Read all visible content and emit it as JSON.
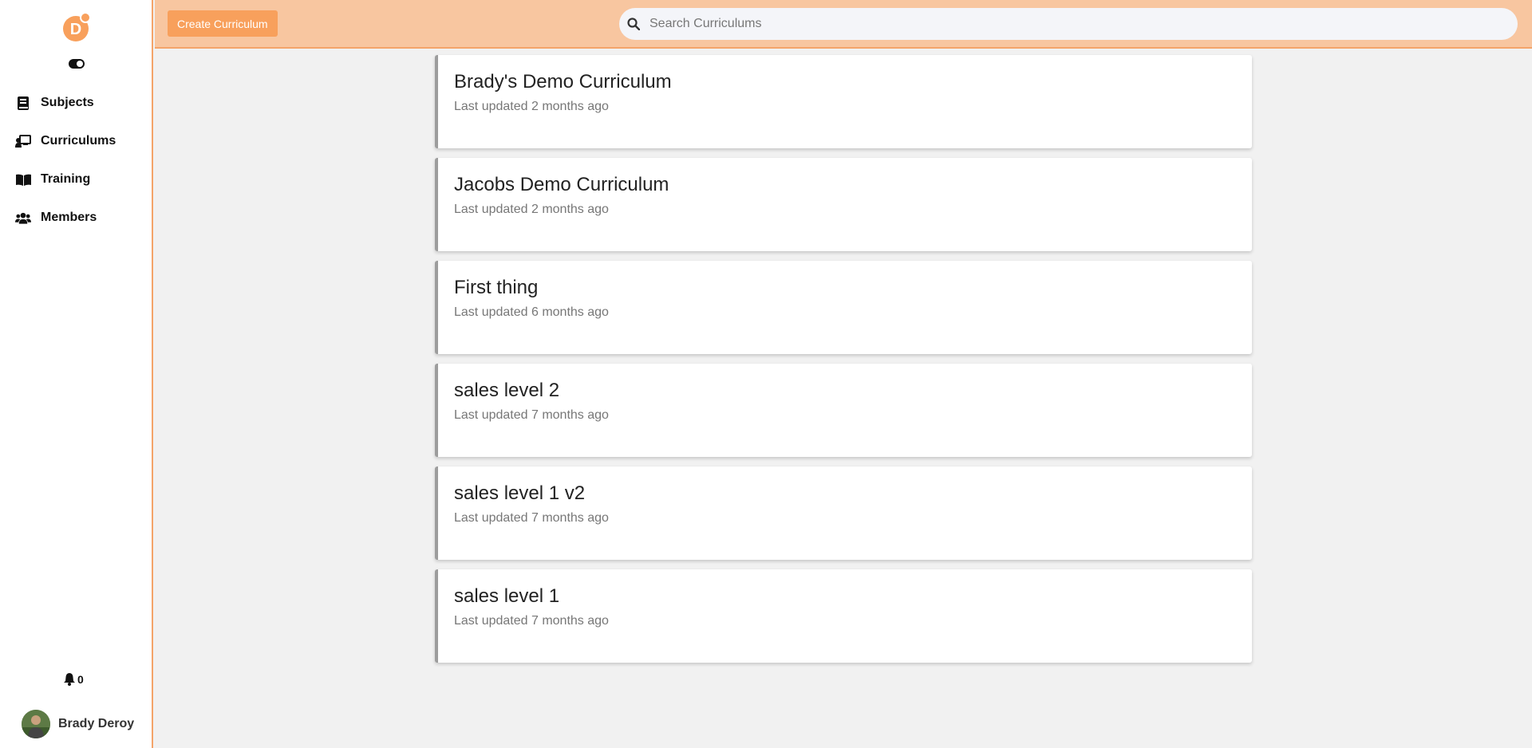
{
  "sidebar": {
    "logo_letter": "D",
    "nav": [
      {
        "label": "Subjects",
        "icon": "book-icon"
      },
      {
        "label": "Curriculums",
        "icon": "chalkboard-teacher-icon"
      },
      {
        "label": "Training",
        "icon": "book-open-icon"
      },
      {
        "label": "Members",
        "icon": "users-icon"
      }
    ],
    "notification_count": "0",
    "user_name": "Brady Deroy"
  },
  "header": {
    "create_button_label": "Create Curriculum",
    "search_placeholder": "Search Curriculums",
    "search_value": ""
  },
  "curriculums": [
    {
      "title": "Brady's Demo Curriculum",
      "updated": "Last updated 2 months ago"
    },
    {
      "title": "Jacobs Demo Curriculum",
      "updated": "Last updated 2 months ago"
    },
    {
      "title": "First thing",
      "updated": "Last updated 6 months ago"
    },
    {
      "title": "sales level 2",
      "updated": "Last updated 7 months ago"
    },
    {
      "title": "sales level 1 v2",
      "updated": "Last updated 7 months ago"
    },
    {
      "title": "sales level 1",
      "updated": "Last updated 7 months ago"
    }
  ],
  "colors": {
    "accent": "#f8a05c",
    "header_bg": "#f8c6a0",
    "border_accent": "#f4a46a",
    "page_bg": "#f1f1f1"
  }
}
